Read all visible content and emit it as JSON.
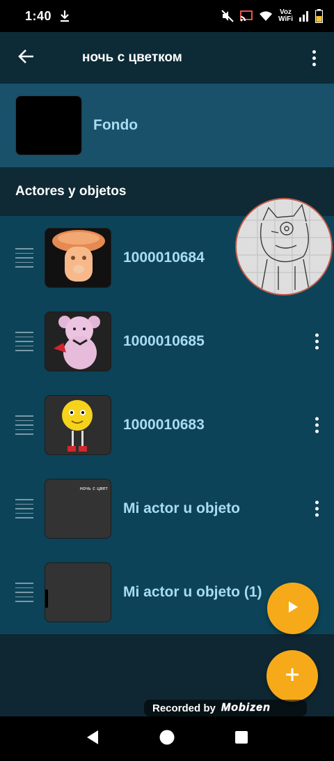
{
  "status_bar": {
    "time": "1:40",
    "voz_line1": "Voz",
    "voz_line2": "WiFi"
  },
  "app_bar": {
    "title": "ночь с цветком",
    "back_icon": "arrow-left-icon",
    "more_icon": "more-vert-icon"
  },
  "background_row": {
    "label": "Fondo"
  },
  "section": {
    "title": "Actores y objetos"
  },
  "actors": [
    {
      "label": "1000010684",
      "thumb": "mushroom-figure"
    },
    {
      "label": "1000010685",
      "thumb": "pink-teddy-bear"
    },
    {
      "label": "1000010683",
      "thumb": "yellow-flower-character"
    },
    {
      "label": "Mi actor u objeto",
      "thumb": "dark-card",
      "thumb_text": "ночь с цвет"
    },
    {
      "label": "Mi actor u objeto (1)",
      "thumb": "dark-card"
    }
  ],
  "fabs": {
    "play_icon": "play-icon",
    "add_icon": "plus-icon"
  },
  "overlay": {
    "recorded_by": "Recorded by",
    "brand": "Mobizen"
  },
  "colors": {
    "accent": "#f6aa1a",
    "list_bg": "#0c4358",
    "fondo_bg": "#19506a",
    "label_blue": "#a9dcf0"
  }
}
